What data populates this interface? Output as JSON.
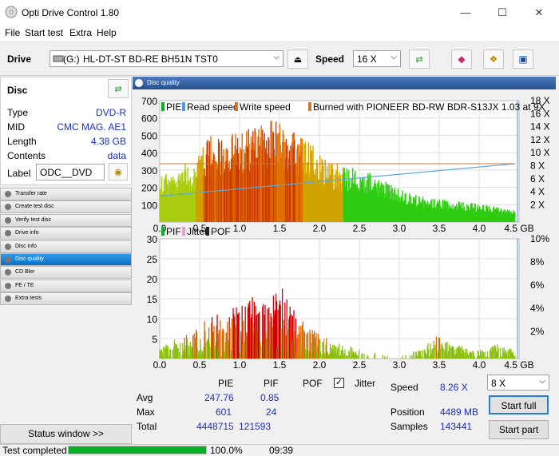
{
  "window": {
    "title": "Opti Drive Control 1.80",
    "minimize": "—",
    "maximize": "☐",
    "close": "✕"
  },
  "menu": [
    "File",
    "Start test",
    "Extra",
    "Help"
  ],
  "toolbar": {
    "drive_label": "Drive",
    "drive_letter": "(G:)",
    "drive_name": "HL-DT-ST BD-RE  BH51N TST0",
    "speed_label": "Speed",
    "speed_value": "16 X"
  },
  "disc": {
    "header": "Disc",
    "rows": [
      {
        "label": "Type",
        "value": "DVD-R"
      },
      {
        "label": "MID",
        "value": "CMC MAG. AE1"
      },
      {
        "label": "Length",
        "value": "4.38 GB"
      },
      {
        "label": "Contents",
        "value": "data"
      }
    ],
    "label_label": "Label",
    "label_value": "ODC__DVD"
  },
  "nav": [
    {
      "label": "Transfer rate",
      "active": false
    },
    {
      "label": "Create test disc",
      "active": false
    },
    {
      "label": "Verify test disc",
      "active": false
    },
    {
      "label": "Drive info",
      "active": false
    },
    {
      "label": "Disc info",
      "active": false
    },
    {
      "label": "Disc quality",
      "active": true
    },
    {
      "label": "CD Bler",
      "active": false
    },
    {
      "label": "FE / TE",
      "active": false
    },
    {
      "label": "Extra tests",
      "active": false
    }
  ],
  "status_window_label": "Status window >>",
  "panel_title": "Disc quality",
  "chart_data": [
    {
      "type": "bar",
      "legend": [
        "PIE",
        "Read speed",
        "Write speed",
        "Burned with PIONEER BD-RW  BDR-S13JX 1.03 at 9X"
      ],
      "x_ticks": [
        "0.0",
        "0.5",
        "1.0",
        "1.5",
        "2.0",
        "2.5",
        "3.0",
        "3.5",
        "4.0",
        "4.5 GB"
      ],
      "y_ticks_left": [
        "700",
        "600",
        "500",
        "400",
        "300",
        "200",
        "100"
      ],
      "y_ticks_right": [
        "18 X",
        "16 X",
        "14 X",
        "12 X",
        "10 X",
        "8 X",
        "6 X",
        "4 X",
        "2 X"
      ],
      "xlim": [
        0,
        4.5
      ],
      "ylim": [
        0,
        700
      ],
      "pie_profile": [
        [
          0.0,
          280
        ],
        [
          0.2,
          260
        ],
        [
          0.3,
          330
        ],
        [
          0.45,
          310
        ],
        [
          0.55,
          460
        ],
        [
          0.7,
          480
        ],
        [
          0.85,
          500
        ],
        [
          1.0,
          490
        ],
        [
          1.1,
          520
        ],
        [
          1.2,
          540
        ],
        [
          1.35,
          560
        ],
        [
          1.5,
          560
        ],
        [
          1.6,
          520
        ],
        [
          1.75,
          470
        ],
        [
          1.9,
          430
        ],
        [
          2.0,
          380
        ],
        [
          2.15,
          330
        ],
        [
          2.3,
          310
        ],
        [
          2.45,
          300
        ],
        [
          2.6,
          280
        ],
        [
          2.8,
          230
        ],
        [
          3.0,
          180
        ],
        [
          3.3,
          140
        ],
        [
          3.6,
          120
        ],
        [
          4.0,
          100
        ],
        [
          4.3,
          80
        ],
        [
          4.45,
          70
        ]
      ],
      "write_speed_x": [
        0.0,
        4.45
      ],
      "write_speed_y": [
        9.0,
        9.0
      ],
      "read_speed_x": [
        0.0,
        4.45
      ],
      "read_speed_y": [
        4.0,
        9.0
      ]
    },
    {
      "type": "bar",
      "legend": [
        "PIF",
        "Jitter",
        "POF"
      ],
      "x_ticks": [
        "0.0",
        "0.5",
        "1.0",
        "1.5",
        "2.0",
        "2.5",
        "3.0",
        "3.5",
        "4.0",
        "4.5 GB"
      ],
      "y_ticks_left": [
        "30",
        "25",
        "20",
        "15",
        "10",
        "5"
      ],
      "y_ticks_right": [
        "10%",
        "8%",
        "6%",
        "4%",
        "2%"
      ],
      "xlim": [
        0,
        4.5
      ],
      "ylim": [
        0,
        30
      ],
      "pif_profile": [
        [
          0.0,
          3
        ],
        [
          0.3,
          6
        ],
        [
          0.5,
          9
        ],
        [
          0.7,
          11
        ],
        [
          0.9,
          13
        ],
        [
          1.0,
          14
        ],
        [
          1.2,
          16
        ],
        [
          1.4,
          18
        ],
        [
          1.5,
          22
        ],
        [
          1.6,
          16
        ],
        [
          1.75,
          10
        ],
        [
          1.9,
          8
        ],
        [
          2.0,
          6
        ],
        [
          2.2,
          4
        ],
        [
          2.4,
          3
        ],
        [
          2.6,
          2
        ],
        [
          2.8,
          1
        ],
        [
          3.0,
          1
        ],
        [
          3.2,
          2
        ],
        [
          3.5,
          6
        ],
        [
          3.7,
          4
        ],
        [
          3.9,
          2
        ],
        [
          4.1,
          3
        ],
        [
          4.3,
          4
        ],
        [
          4.45,
          2
        ]
      ]
    }
  ],
  "stats": {
    "col_pie": "PIE",
    "col_pif": "PIF",
    "col_pof": "POF",
    "jitter_label": "Jitter",
    "avg_label": "Avg",
    "avg_pie": "247.76",
    "avg_pif": "0.85",
    "max_label": "Max",
    "max_pie": "601",
    "max_pif": "24",
    "total_label": "Total",
    "total_pie": "4448715",
    "total_pif": "121593",
    "speed_label": "Speed",
    "speed_value": "8.26 X",
    "position_label": "Position",
    "position_value": "4489 MB",
    "samples_label": "Samples",
    "samples_value": "143441",
    "test_speed": "8 X",
    "start_full": "Start full",
    "start_part": "Start part"
  },
  "statusbar": {
    "text": "Test completed",
    "progress_value": 1.0,
    "progress_label": "100.0%",
    "time": "09:39"
  },
  "colors": {
    "progress": "#06b025",
    "accent_blue": "#1a30c8",
    "nav_active": "#1a7fd6"
  }
}
